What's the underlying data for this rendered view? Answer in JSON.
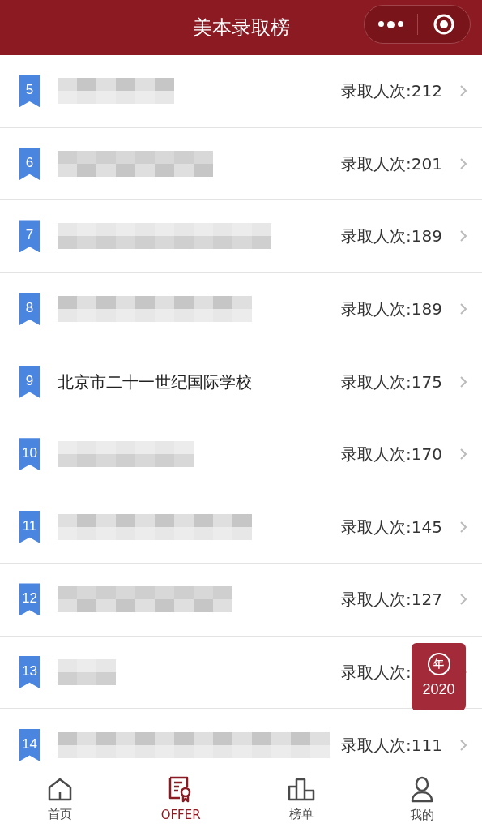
{
  "header": {
    "title": "美本录取榜"
  },
  "rows": [
    {
      "rank": "5",
      "kind": "blurred",
      "count": "录取人次:212"
    },
    {
      "rank": "6",
      "kind": "blurred",
      "count": "录取人次:201"
    },
    {
      "rank": "7",
      "kind": "blurred",
      "count": "录取人次:189"
    },
    {
      "rank": "8",
      "kind": "blurred",
      "count": "录取人次:189"
    },
    {
      "rank": "9",
      "kind": "text",
      "name": "北京市二十一世纪国际学校",
      "count": "录取人次:175"
    },
    {
      "rank": "10",
      "kind": "blurred",
      "count": "录取人次:170"
    },
    {
      "rank": "11",
      "kind": "blurred",
      "count": "录取人次:145"
    },
    {
      "rank": "12",
      "kind": "blurred",
      "count": "录取人次:127"
    },
    {
      "rank": "13",
      "kind": "blurred",
      "count": "录取人次:"
    },
    {
      "rank": "14",
      "kind": "blurred",
      "count": "录取人次:111"
    }
  ],
  "year_badge": {
    "icon_text": "年",
    "year": "2020"
  },
  "tabs": [
    {
      "label": "首页",
      "kind": "home",
      "selected": false
    },
    {
      "label": "OFFER",
      "kind": "certificate",
      "selected": true
    },
    {
      "label": "榜单",
      "kind": "chart",
      "selected": false
    },
    {
      "label": "我的",
      "kind": "user",
      "selected": false
    }
  ]
}
